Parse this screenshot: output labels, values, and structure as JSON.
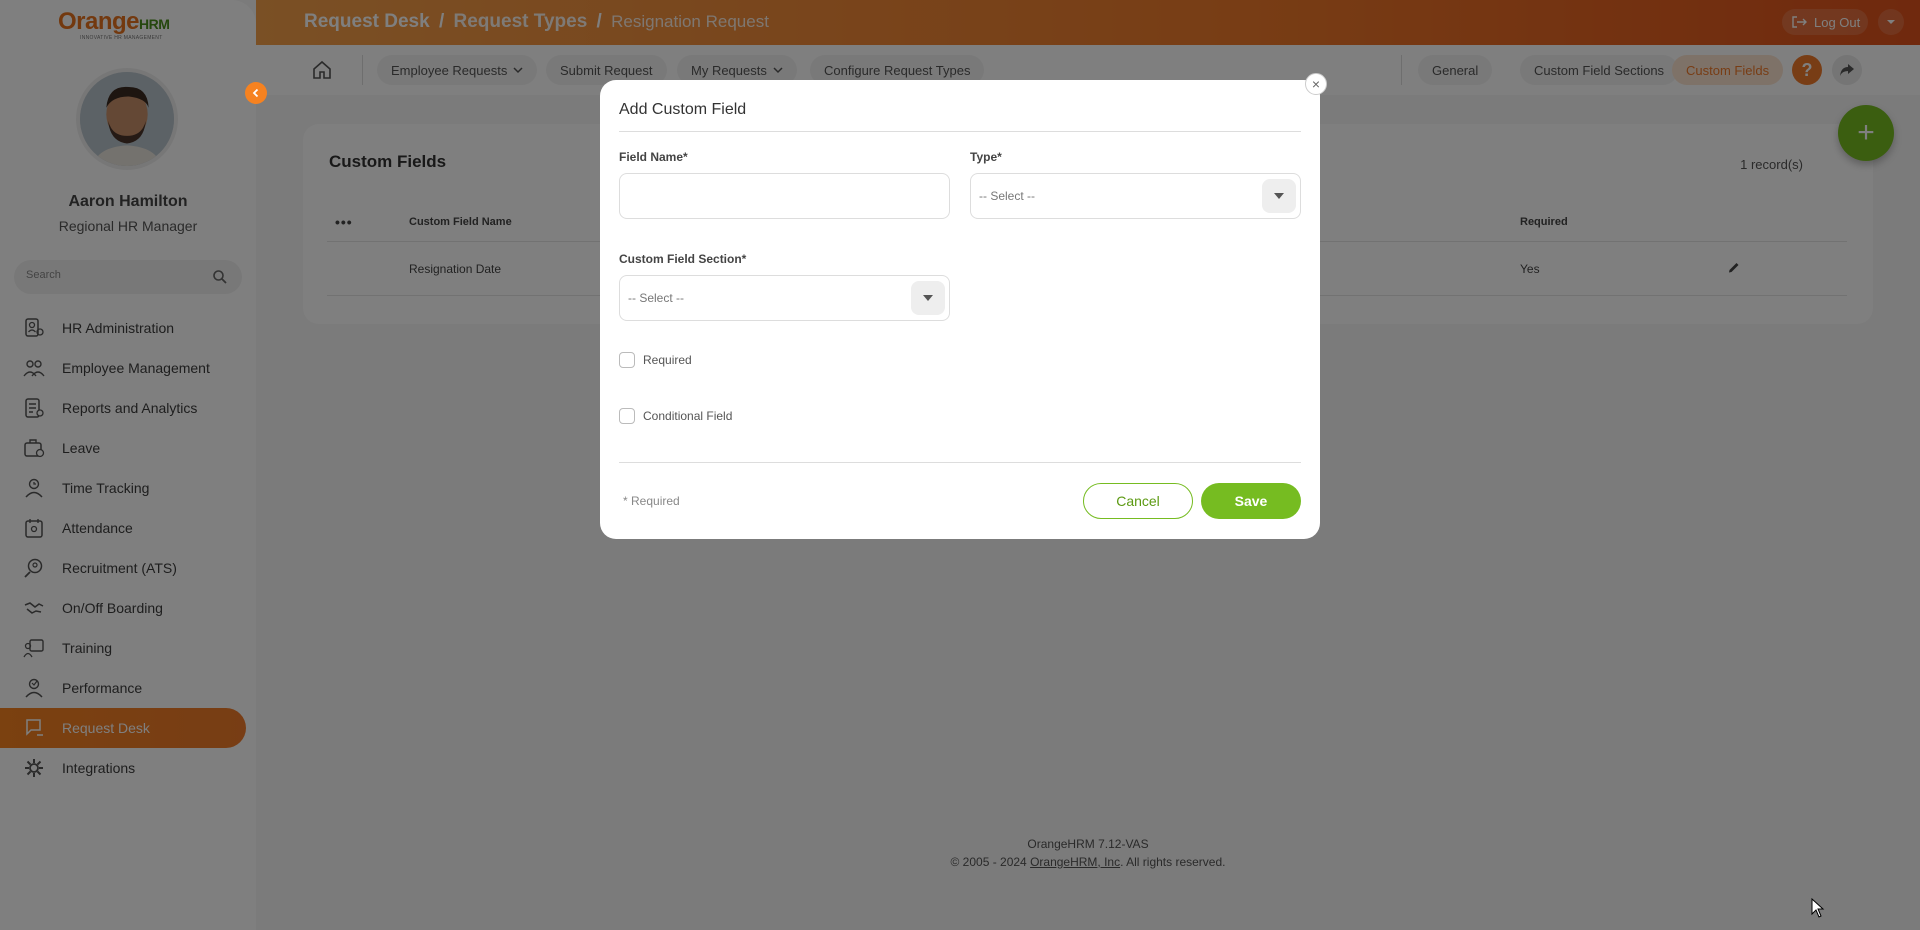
{
  "app": {
    "logo_main": "Orange",
    "logo_hrm": "HRM",
    "logo_tagline": "INNOVATIVE HR MANAGEMENT"
  },
  "user": {
    "name": "Aaron Hamilton",
    "role": "Regional HR Manager"
  },
  "sidebar": {
    "search_placeholder": "Search",
    "items": [
      {
        "label": "HR Administration",
        "icon": "hr-admin-icon"
      },
      {
        "label": "Employee Management",
        "icon": "employee-management-icon"
      },
      {
        "label": "Reports and Analytics",
        "icon": "reports-icon"
      },
      {
        "label": "Leave",
        "icon": "leave-icon"
      },
      {
        "label": "Time Tracking",
        "icon": "time-tracking-icon"
      },
      {
        "label": "Attendance",
        "icon": "attendance-icon"
      },
      {
        "label": "Recruitment (ATS)",
        "icon": "recruitment-icon"
      },
      {
        "label": "On/Off Boarding",
        "icon": "onboarding-icon"
      },
      {
        "label": "Training",
        "icon": "training-icon"
      },
      {
        "label": "Performance",
        "icon": "performance-icon"
      },
      {
        "label": "Request Desk",
        "icon": "request-desk-icon",
        "active": true
      },
      {
        "label": "Integrations",
        "icon": "integrations-icon"
      }
    ]
  },
  "header": {
    "breadcrumb_main": "Request Desk",
    "breadcrumb_sep1": "/",
    "breadcrumb_mid": "Request Types",
    "breadcrumb_sep2": "/",
    "breadcrumb_last": "Resignation Request",
    "logout_label": "Log Out"
  },
  "nav": {
    "employee_requests": "Employee Requests",
    "submit_request": "Submit Request",
    "my_requests": "My Requests",
    "configure_request_types": "Configure Request Types",
    "general": "General",
    "custom_field_sections": "Custom Field Sections",
    "custom_fields": "Custom Fields",
    "help": "?"
  },
  "main": {
    "title": "Custom Fields",
    "record_count": "1 record(s)",
    "columns": {
      "actions": "•••",
      "name": "Custom Field Name",
      "required": "Required"
    },
    "rows": [
      {
        "name": "Resignation Date",
        "required": "Yes"
      }
    ],
    "fab": "+"
  },
  "modal": {
    "title": "Add Custom Field",
    "close": "×",
    "field_name_label": "Field Name*",
    "field_name_value": "",
    "type_label": "Type*",
    "type_value": "-- Select --",
    "section_label": "Custom Field Section*",
    "section_value": "-- Select --",
    "required_label": "Required",
    "conditional_label": "Conditional Field",
    "required_note": "* Required",
    "cancel_label": "Cancel",
    "save_label": "Save"
  },
  "footer": {
    "version": "OrangeHRM 7.12-VAS",
    "copyright_prefix": "© 2005 - 2024 ",
    "company_link": "OrangeHRM, Inc",
    "copyright_suffix": ". All rights reserved."
  },
  "colors": {
    "brand_orange": "#f07a2a",
    "brand_green": "#76bc21"
  }
}
